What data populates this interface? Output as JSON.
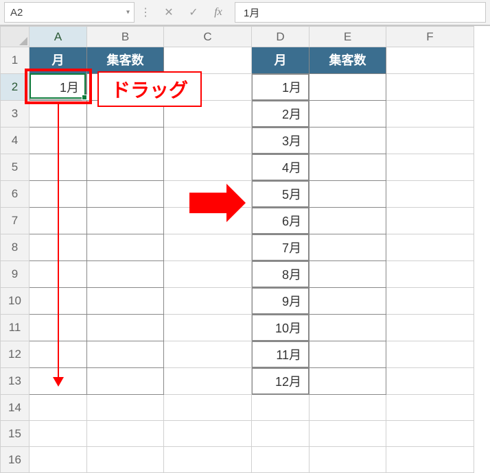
{
  "name_box": "A2",
  "formula_value": "1月",
  "columns": [
    "A",
    "B",
    "C",
    "D",
    "E",
    "F"
  ],
  "rows": [
    "1",
    "2",
    "3",
    "4",
    "5",
    "6",
    "7",
    "8",
    "9",
    "10",
    "11",
    "12",
    "13",
    "14",
    "15",
    "16"
  ],
  "active_column_index": 0,
  "active_row_index": 1,
  "left_table": {
    "headers": {
      "month": "月",
      "visitors": "集客数"
    },
    "data": [
      "1月"
    ]
  },
  "right_table": {
    "headers": {
      "month": "月",
      "visitors": "集客数"
    },
    "data": [
      "1月",
      "2月",
      "3月",
      "4月",
      "5月",
      "6月",
      "7月",
      "8月",
      "9月",
      "10月",
      "11月",
      "12月"
    ]
  },
  "drag_label": "ドラッグ",
  "icons": {
    "dropdown": "▾",
    "dots": "⋮",
    "cancel": "✕",
    "confirm": "✓",
    "fx": "fx"
  }
}
